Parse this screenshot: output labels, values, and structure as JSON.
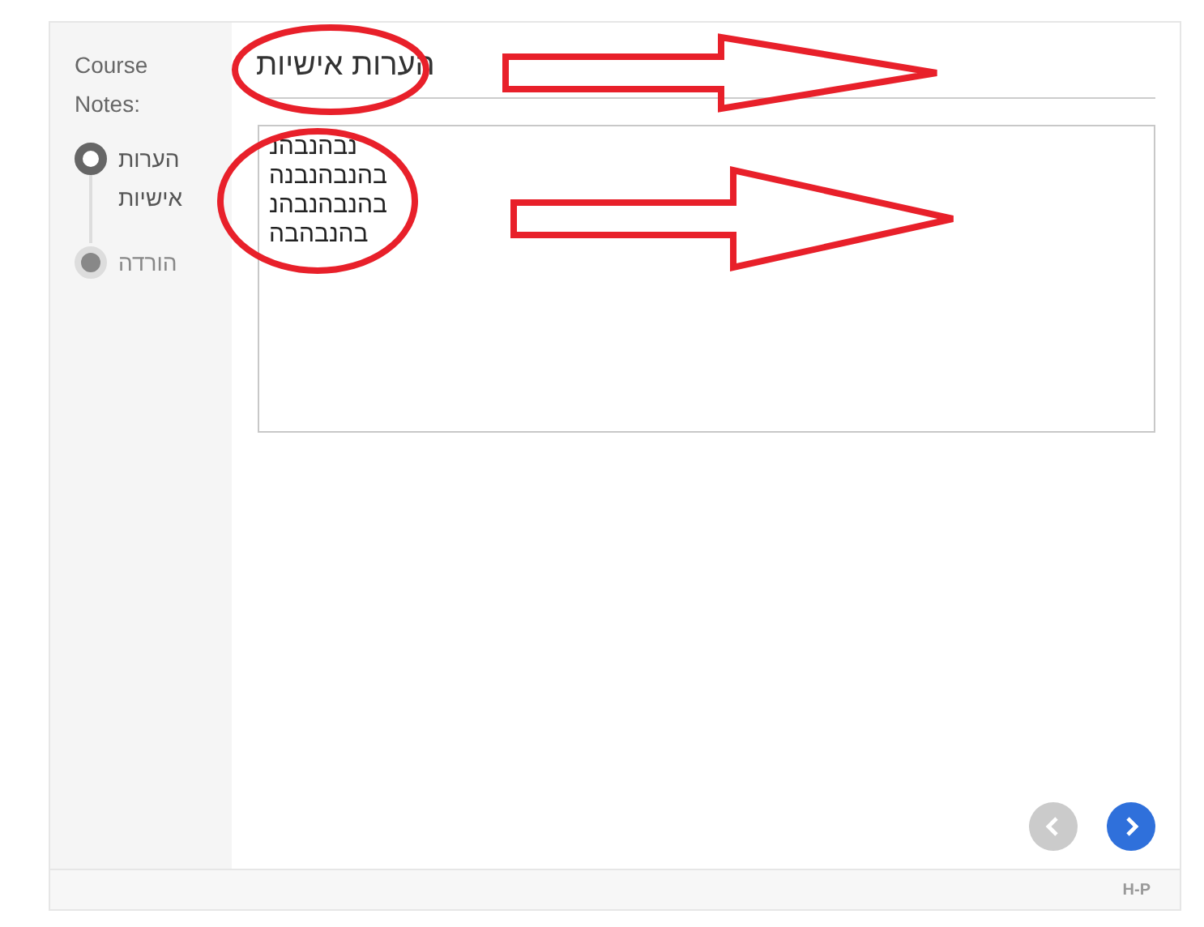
{
  "sidebar": {
    "title": "Course Notes:",
    "steps": [
      {
        "label": "הערות אישיות",
        "selected": true
      },
      {
        "label": "הורדה",
        "selected": false
      }
    ]
  },
  "content": {
    "title": "הערות אישיות",
    "notes": {
      "value": "נבהנבהנ\nבהנבהנבנה\nבהנבהנבהנ\nבהנבהבה"
    }
  },
  "navigation": [
    {
      "kind": "previous",
      "disabled": true
    },
    {
      "kind": "next",
      "disabled": false
    }
  ],
  "footer": {
    "logo": "H-P"
  },
  "annotations": [
    {
      "kind": "ellipse"
    },
    {
      "kind": "ellipse"
    },
    {
      "kind": "arrow"
    },
    {
      "kind": "arrow"
    }
  ]
}
